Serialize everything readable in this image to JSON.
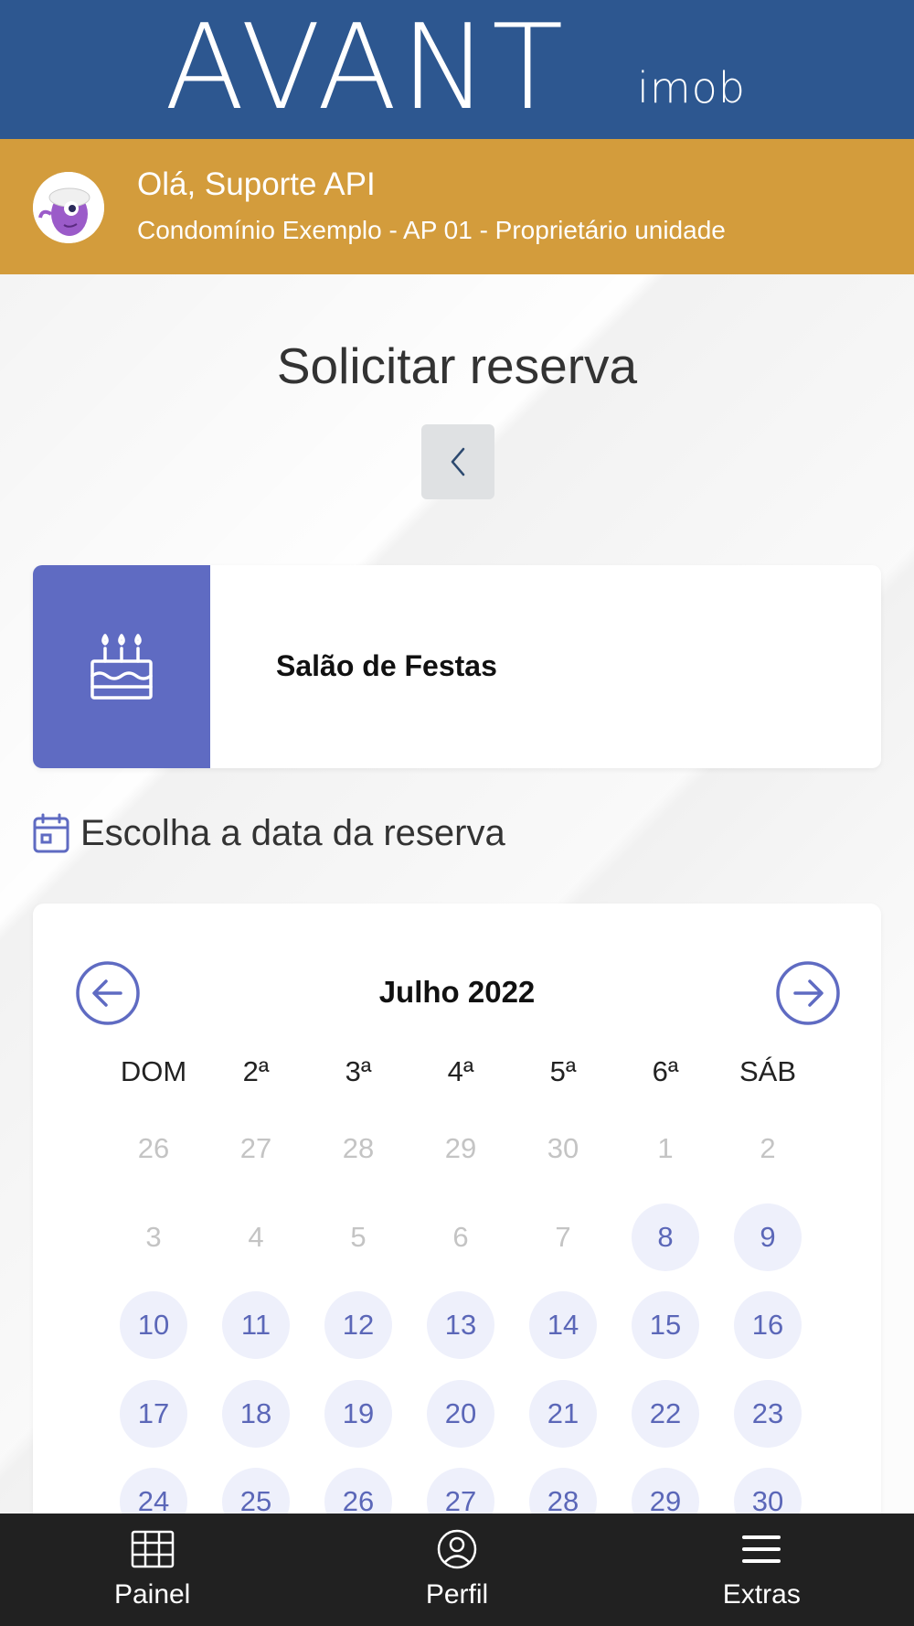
{
  "header": {
    "logo_main": "AVANT",
    "logo_sub": "imob",
    "brand_color": "#2d5790"
  },
  "user_bar": {
    "greeting": "Olá, Suporte API",
    "unit": "Condomínio Exemplo - AP 01 - Proprietário unidade",
    "avatar_icon": "purple-monster-avatar",
    "color": "#d39c3c"
  },
  "page": {
    "title": "Solicitar reserva",
    "back_icon": "chevron-left-icon"
  },
  "facility": {
    "name": "Salão de Festas",
    "icon": "birthday-cake-icon",
    "accent_color": "#5f6bc2"
  },
  "date_section": {
    "label": "Escolha a data da reserva",
    "icon": "calendar-icon"
  },
  "calendar": {
    "month_label": "Julho 2022",
    "prev_icon": "arrow-left-circle-icon",
    "next_icon": "arrow-right-circle-icon",
    "weekdays": [
      "DOM",
      "2ª",
      "3ª",
      "4ª",
      "5ª",
      "6ª",
      "SÁB"
    ],
    "weeks": [
      [
        {
          "d": "26",
          "on": false
        },
        {
          "d": "27",
          "on": false
        },
        {
          "d": "28",
          "on": false
        },
        {
          "d": "29",
          "on": false
        },
        {
          "d": "30",
          "on": false
        },
        {
          "d": "1",
          "on": false
        },
        {
          "d": "2",
          "on": false
        }
      ],
      [
        {
          "d": "3",
          "on": false
        },
        {
          "d": "4",
          "on": false
        },
        {
          "d": "5",
          "on": false
        },
        {
          "d": "6",
          "on": false
        },
        {
          "d": "7",
          "on": false
        },
        {
          "d": "8",
          "on": true
        },
        {
          "d": "9",
          "on": true
        }
      ],
      [
        {
          "d": "10",
          "on": true
        },
        {
          "d": "11",
          "on": true
        },
        {
          "d": "12",
          "on": true
        },
        {
          "d": "13",
          "on": true
        },
        {
          "d": "14",
          "on": true
        },
        {
          "d": "15",
          "on": true
        },
        {
          "d": "16",
          "on": true
        }
      ],
      [
        {
          "d": "17",
          "on": true
        },
        {
          "d": "18",
          "on": true
        },
        {
          "d": "19",
          "on": true
        },
        {
          "d": "20",
          "on": true
        },
        {
          "d": "21",
          "on": true
        },
        {
          "d": "22",
          "on": true
        },
        {
          "d": "23",
          "on": true
        }
      ],
      [
        {
          "d": "24",
          "on": true
        },
        {
          "d": "25",
          "on": true
        },
        {
          "d": "26",
          "on": true
        },
        {
          "d": "27",
          "on": true
        },
        {
          "d": "28",
          "on": true
        },
        {
          "d": "29",
          "on": true
        },
        {
          "d": "30",
          "on": true
        }
      ]
    ]
  },
  "bottom_nav": {
    "items": [
      {
        "label": "Painel",
        "icon": "grid-table-icon"
      },
      {
        "label": "Perfil",
        "icon": "user-circle-icon"
      },
      {
        "label": "Extras",
        "icon": "hamburger-menu-icon"
      }
    ]
  }
}
